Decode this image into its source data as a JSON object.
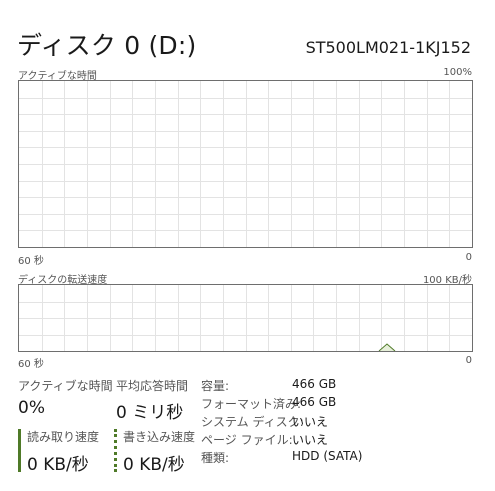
{
  "header": {
    "title": "ディスク 0 (D:)",
    "model": "ST500LM021-1KJ152"
  },
  "active_time_graph": {
    "label": "アクティブな時間",
    "max_label": "100%",
    "time_label": "60 秒",
    "min_label": "0"
  },
  "transfer_graph": {
    "label": "ディスクの転送速度",
    "max_label": "100 KB/秒",
    "time_label": "60 秒",
    "min_label": "0",
    "color": "#4f7a28"
  },
  "stats": {
    "active_time": {
      "label": "アクティブな時間",
      "value": "0%"
    },
    "response_time": {
      "label": "平均応答時間",
      "value": "0 ミリ秒"
    },
    "read_speed": {
      "label": "読み取り速度",
      "value": "0 KB/秒"
    },
    "write_speed": {
      "label": "書き込み速度",
      "value": "0 KB/秒"
    }
  },
  "properties": [
    {
      "label": "容量:",
      "value": "466 GB"
    },
    {
      "label": "フォーマット済み:",
      "value": "466 GB"
    },
    {
      "label": "システム ディスク:",
      "value": "いいえ"
    },
    {
      "label": "ページ ファイル:",
      "value": "いいえ"
    },
    {
      "label": "種類:",
      "value": "HDD (SATA)"
    }
  ],
  "colors": {
    "grid": "#e3e3e3",
    "border": "#6e6e6e",
    "accent": "#4f7a28"
  }
}
